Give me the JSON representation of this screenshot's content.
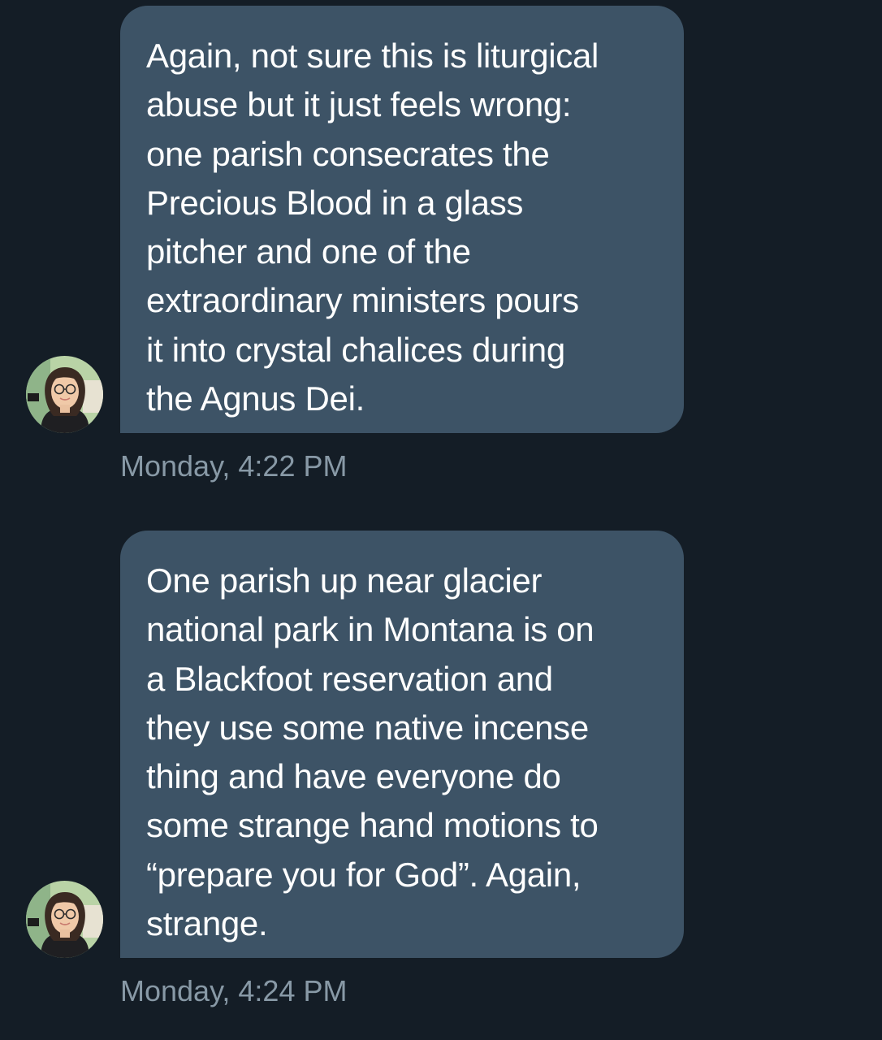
{
  "messages": [
    {
      "lines": [
        "Again, not sure this is liturgical",
        "abuse but it just feels wrong:",
        "one parish consecrates the",
        "Precious Blood in a glass",
        "pitcher and one of the",
        "extraordinary ministers pours",
        "it into crystal chalices during",
        "the Agnus Dei."
      ],
      "timestamp": "Monday, 4:22 PM"
    },
    {
      "lines": [
        "One parish up near glacier",
        "national park in Montana is on",
        "a Blackfoot reservation and",
        "they use some native incense",
        "thing and have everyone do",
        "some strange hand motions to",
        "“prepare you for God”. Again,",
        "strange."
      ],
      "timestamp": "Monday, 4:24 PM"
    }
  ],
  "colors": {
    "background": "#141d26",
    "bubble": "#3d5366",
    "message_text": "#ffffff",
    "timestamp_text": "#8899a6"
  }
}
